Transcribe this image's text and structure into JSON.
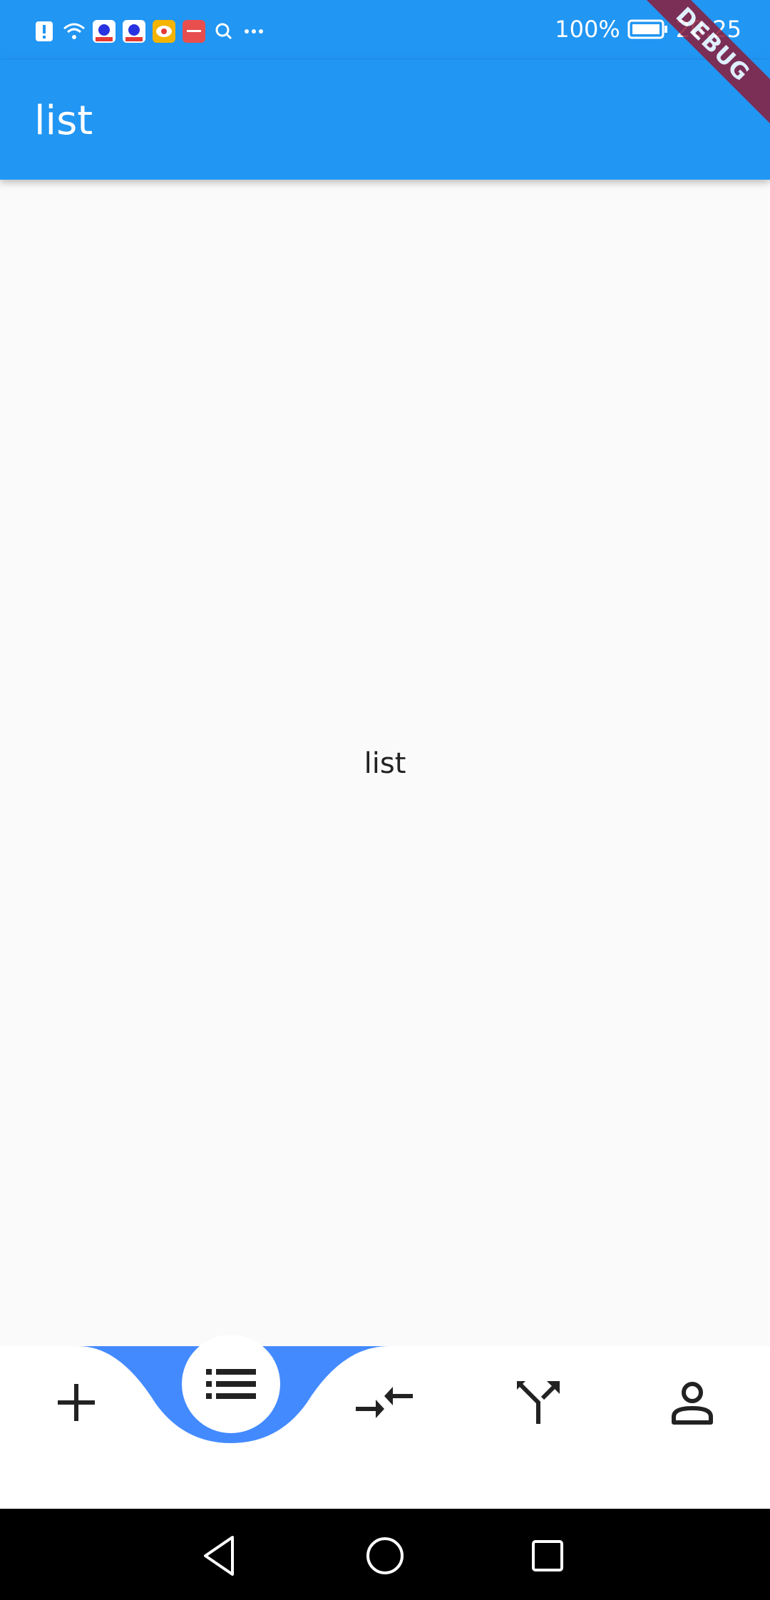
{
  "status_bar": {
    "battery_text": "100%",
    "time": "20:25",
    "notification_icons": [
      "alert-icon",
      "wifi-icon",
      "baidu-icon",
      "baidu-icon",
      "weibo-icon",
      "huawei-icon",
      "search-icon",
      "more-dots-icon"
    ]
  },
  "app_bar": {
    "title": "list"
  },
  "debug_banner": "DEBUG",
  "body": {
    "text": "list"
  },
  "bottom_nav": {
    "items": [
      {
        "name": "add",
        "icon": "plus-icon"
      },
      {
        "name": "list",
        "icon": "list-icon",
        "selected": true
      },
      {
        "name": "compare",
        "icon": "compare-arrows-icon"
      },
      {
        "name": "call-split",
        "icon": "call-split-icon"
      },
      {
        "name": "person",
        "icon": "person-icon"
      }
    ],
    "accent_color": "#448aff"
  },
  "colors": {
    "primary": "#2196f3",
    "background": "#fafafa",
    "debug": "#8b1d3b"
  }
}
